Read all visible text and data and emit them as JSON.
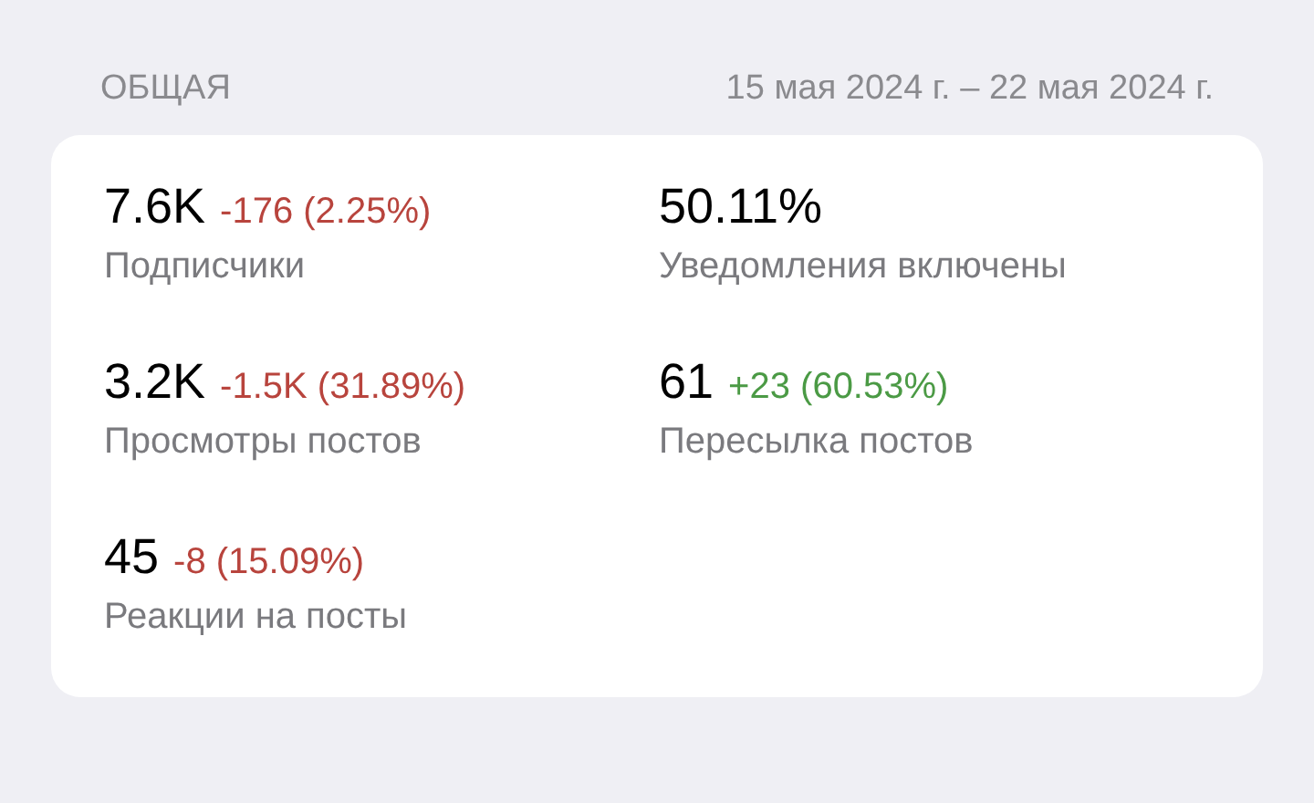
{
  "section": {
    "title": "ОБЩАЯ",
    "date_range": "15 мая 2024 г. – 22 мая 2024 г."
  },
  "stats": [
    {
      "value": "7.6K",
      "delta": "-176 (2.25%)",
      "color": "#b8443d",
      "label": "Подписчики"
    },
    {
      "value": "50.11%",
      "label": "Уведомления включены"
    },
    {
      "value": "3.2K",
      "delta": "-1.5K (31.89%)",
      "color": "#b8443d",
      "label": "Просмотры постов"
    },
    {
      "value": "61",
      "delta": "+23 (60.53%)",
      "color": "#4b9a45",
      "label": "Пересылка постов"
    },
    {
      "value": "45",
      "delta": "-8 (15.09%)",
      "color": "#b8443d",
      "label": "Реакции на посты"
    }
  ]
}
